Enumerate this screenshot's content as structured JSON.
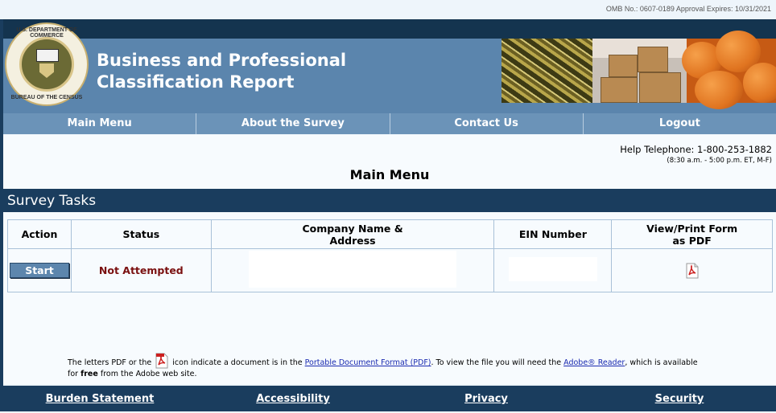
{
  "omb": "OMB No.: 0607-0189 Approval Expires: 10/31/2021",
  "header": {
    "title_line1": "Business and Professional",
    "title_line2": "Classification Report",
    "seal_top": "U.S. DEPARTMENT OF COMMERCE",
    "seal_bottom": "BUREAU OF THE CENSUS"
  },
  "nav": [
    "Main Menu",
    "About the Survey",
    "Contact Us",
    "Logout"
  ],
  "help": {
    "phone": "Help Telephone: 1-800-253-1882",
    "hours": "(8:30 a.m. - 5:00 p.m. ET, M-F)"
  },
  "page_title": "Main Menu",
  "section_title": "Survey Tasks",
  "table": {
    "headers": [
      "Action",
      "Status",
      "Company Name & Address",
      "EIN Number",
      "View/Print Form as PDF"
    ],
    "header_company_line1": "Company Name &",
    "header_company_line2": "Address",
    "header_pdf_line1": "View/Print Form",
    "header_pdf_line2": "as PDF",
    "row": {
      "action": "Start",
      "status": "Not Attempted"
    }
  },
  "note": {
    "part1": "The letters PDF or the",
    "part2": "icon indicate a document is in the",
    "link1": "Portable Document Format (PDF)",
    "part3": ". To view the file you will need the",
    "link2": "Adobe® Reader",
    "part4": ", which is available",
    "part5": "for",
    "bold": "free",
    "part6": "from the Adobe web site."
  },
  "footer": [
    "Burden Statement",
    "Accessibility",
    "Privacy",
    "Security"
  ],
  "colors": {
    "header_blue": "#5b85ad",
    "dark_navy": "#1a3d5e",
    "status_red": "#7a1010",
    "link_blue": "#1a2ab0"
  },
  "icons": [
    "census-seal-logo",
    "pdf-icon"
  ]
}
